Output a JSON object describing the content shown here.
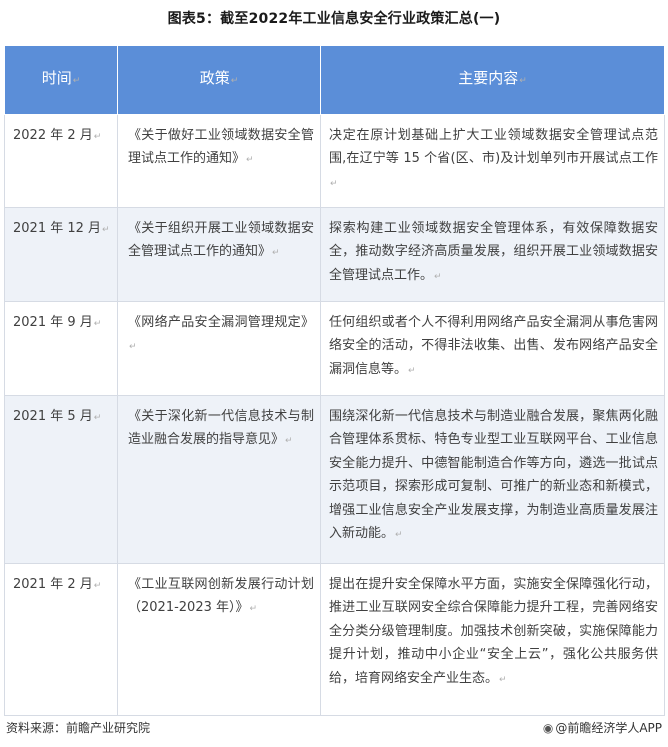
{
  "title": "图表5：截至2022年工业信息安全行业政策汇总(一)",
  "table": {
    "headers": [
      "时间",
      "政策",
      "主要内容"
    ],
    "rows": [
      {
        "time": "2022 年 2 月",
        "policy": "《关于做好工业领域数据安全管理试点工作的通知》",
        "content": "决定在原计划基础上扩大工业领域数据安全管理试点范围,在辽宁等 15 个省(区、市)及计划单列市开展试点工作"
      },
      {
        "time": "2021 年 12 月",
        "policy": "《关于组织开展工业领域数据安全管理试点工作的通知》",
        "content": "探索构建工业领域数据安全管理体系，有效保障数据安全，推动数字经济高质量发展，组织开展工业领域数据安全管理试点工作。"
      },
      {
        "time": "2021 年 9 月",
        "policy": "《网络产品安全漏洞管理规定》",
        "content": "任何组织或者个人不得利用网络产品安全漏洞从事危害网络安全的活动，不得非法收集、出售、发布网络产品安全漏洞信息等。"
      },
      {
        "time": "2021 年 5 月",
        "policy": "《关于深化新一代信息技术与制造业融合发展的指导意见》",
        "content": "围绕深化新一代信息技术与制造业融合发展，聚焦两化融合管理体系贯标、特色专业型工业互联网平台、工业信息安全能力提升、中德智能制造合作等方向，遴选一批试点示范项目，探索形成可复制、可推广的新业态和新模式，增强工业信息安全产业发展支撑，为制造业高质量发展注入新动能。"
      },
      {
        "time": "2021 年 2 月",
        "policy": "《工业互联网创新发展行动计划（2021-2023 年）》",
        "content": "提出在提升安全保障水平方面，实施安全保障强化行动，推进工业互联网安全综合保障能力提升工程，完善网络安全分类分级管理制度。加强技术创新突破，实施保障能力提升计划，推动中小企业“安全上云”，强化公共服务供给，培育网络安全产业生态。"
      }
    ]
  },
  "paragraph_mark": "↵",
  "footer": {
    "source": "资料来源：前瞻产业研究院",
    "brand_icon": "weibo-icon",
    "brand": "@前瞻经济学人APP"
  }
}
